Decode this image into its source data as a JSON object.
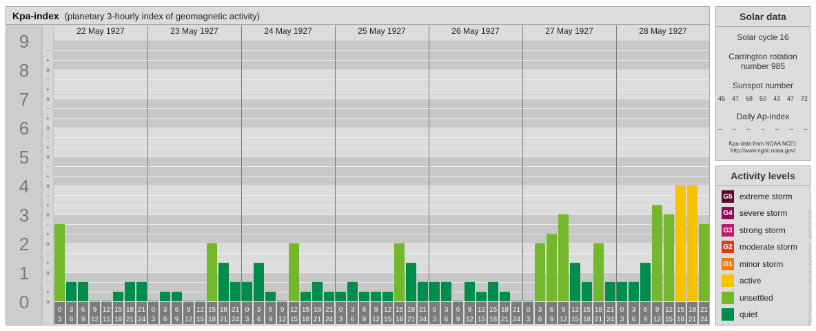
{
  "title": {
    "main": "Kpa-index",
    "sub": "(planetary 3-hourly index of geomagnetic activity)"
  },
  "chart_data": {
    "type": "bar",
    "title": "Kpa-index",
    "y_ticks": [
      "0",
      "1",
      "2",
      "3",
      "4",
      "5",
      "6",
      "7",
      "8",
      "9"
    ],
    "y_minor_marks": [
      "o",
      "+",
      "-"
    ],
    "ylim": [
      0,
      9
    ],
    "days": [
      "22 May 1927",
      "23 May 1927",
      "24 May 1927",
      "25 May 1927",
      "26 May 1927",
      "27 May 1927",
      "28 May 1927"
    ],
    "interval_labels": [
      [
        "0",
        "3"
      ],
      [
        "3",
        "6"
      ],
      [
        "6",
        "9"
      ],
      [
        "9",
        "12"
      ],
      [
        "12",
        "15"
      ],
      [
        "15",
        "18"
      ],
      [
        "18",
        "21"
      ],
      [
        "21",
        "24"
      ]
    ],
    "values": [
      2.67,
      0.67,
      0.67,
      0,
      0,
      0.33,
      0.67,
      0.67,
      0,
      0.33,
      0.33,
      0,
      0,
      2,
      1.33,
      0.67,
      0.67,
      1.33,
      0.33,
      0,
      2,
      0.33,
      0.67,
      0.33,
      0.33,
      0.67,
      0.33,
      0.33,
      0.33,
      2,
      1.33,
      0.67,
      0.67,
      0.67,
      0,
      0.67,
      0.33,
      0.67,
      0.33,
      0,
      0,
      2,
      2.33,
      3,
      1.33,
      0.67,
      2,
      0.67,
      0.67,
      0.67,
      1.33,
      3.33,
      3,
      4,
      4,
      2.67
    ],
    "level_colors": {
      "quiet": "#008c4a",
      "unsettled": "#72b82a",
      "active": "#f7c300"
    }
  },
  "solar": {
    "heading": "Solar data",
    "cycle": "Solar cycle 16",
    "carrington_line1": "Carrington rotation",
    "carrington_line2": "number 985",
    "sunspot_label": "Sunspot number",
    "sunspot_values": [
      "45",
      "47",
      "68",
      "50",
      "43",
      "47",
      "72"
    ],
    "ap_label": "Daily Ap-index",
    "ap_values": [
      "--",
      "--",
      "--",
      "--",
      "--",
      "--",
      "--"
    ],
    "source_line1": "Kpa-data from NOAA NCEI:",
    "source_line2": "http://www.ngdc.noaa.gov/"
  },
  "activity": {
    "heading": "Activity levels",
    "levels": [
      {
        "code": "G5",
        "label": "extreme storm",
        "color": "#5a0a2e"
      },
      {
        "code": "G4",
        "label": "severe storm",
        "color": "#8a0f55"
      },
      {
        "code": "G3",
        "label": "strong storm",
        "color": "#c0186e"
      },
      {
        "code": "G2",
        "label": "moderate storm",
        "color": "#e03a17"
      },
      {
        "code": "G1",
        "label": "minor storm",
        "color": "#ef7b16"
      },
      {
        "code": "",
        "label": "active",
        "color": "#f7c300"
      },
      {
        "code": "",
        "label": "unsettled",
        "color": "#72b82a"
      },
      {
        "code": "",
        "label": "quiet",
        "color": "#008c4a"
      }
    ]
  },
  "watermark": "http://www.tesis.lebedev.ru/en/sun_archive.html"
}
